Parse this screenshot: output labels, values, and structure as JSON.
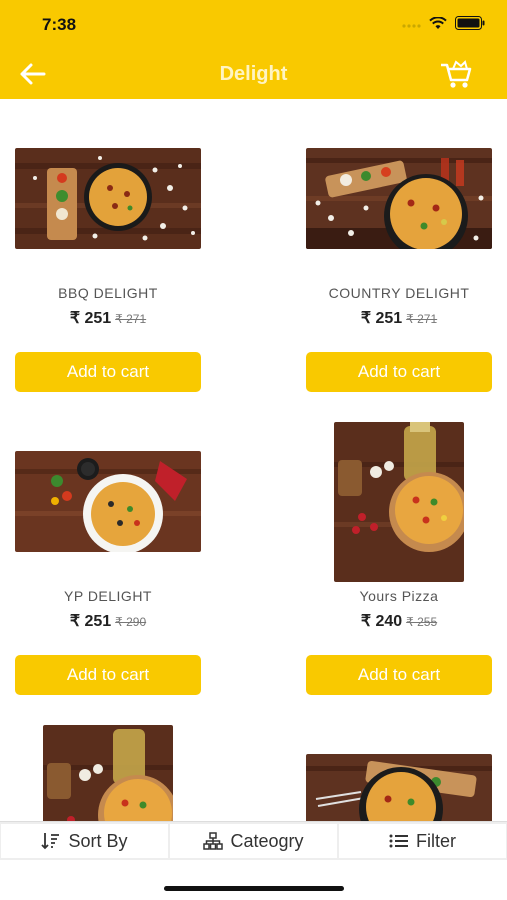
{
  "status": {
    "time": "7:38"
  },
  "header": {
    "title": "Delight"
  },
  "products": [
    {
      "name": "BBQ DELIGHT",
      "price": "₹ 251",
      "old_price": "₹ 271",
      "button": "Add to cart"
    },
    {
      "name": "COUNTRY DELIGHT",
      "price": "₹ 251",
      "old_price": "₹ 271",
      "button": "Add to cart"
    },
    {
      "name": "YP DELIGHT",
      "price": "₹ 251",
      "old_price": "₹ 290",
      "button": "Add to cart"
    },
    {
      "name": "Yours Pizza",
      "price": "₹ 240",
      "old_price": "₹ 255",
      "button": "Add to cart"
    }
  ],
  "bottom_bar": {
    "sort_label": "Sort By",
    "category_label": "Cateogry",
    "filter_label": "Filter"
  },
  "colors": {
    "accent": "#f9c900",
    "title_text": "#fff4c2"
  },
  "icons": [
    "back-arrow-icon",
    "cart-icon",
    "sort-icon",
    "category-icon",
    "filter-icon",
    "wifi-icon",
    "battery-icon",
    "signal-icon"
  ]
}
